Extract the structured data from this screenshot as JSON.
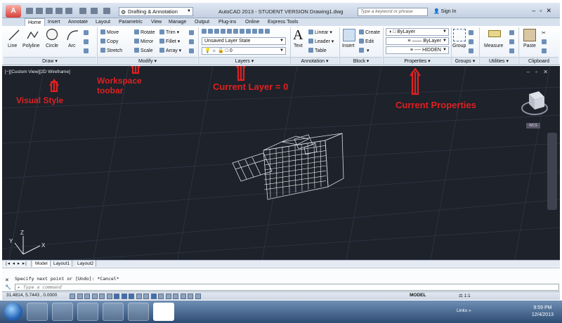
{
  "titlebar": {
    "workspace": "Drafting & Annotation",
    "title": "AutoCAD 2013 - STUDENT VERSION   Drawing1.dwg",
    "search_placeholder": "Type a keyword or phrase",
    "signin": "Sign In"
  },
  "tabs": [
    "Home",
    "Insert",
    "Annotate",
    "Layout",
    "Parametric",
    "View",
    "Manage",
    "Output",
    "Plug-ins",
    "Online",
    "Express Tools"
  ],
  "ribbon": {
    "draw": {
      "line": "Line",
      "polyline": "Polyline",
      "circle": "Circle",
      "arc": "Arc",
      "label": "Draw"
    },
    "modify": {
      "move": "Move",
      "rotate": "Rotate",
      "trim": "Trim",
      "copy": "Copy",
      "mirror": "Mirror",
      "fillet": "Fillet",
      "stretch": "Stretch",
      "scale": "Scale",
      "array": "Array",
      "label": "Modify"
    },
    "layers": {
      "layer_state": "Unsaved Layer State",
      "current_layer": "0",
      "label": "Layers"
    },
    "annotation": {
      "text": "Text",
      "linear": "Linear",
      "leader": "Leader",
      "table": "Table",
      "label": "Annotation"
    },
    "block": {
      "insert": "Insert",
      "create": "Create",
      "edit": "Edit",
      "label": "Block"
    },
    "properties": {
      "color": "ByLayer",
      "linetype": "ByLayer",
      "lineweight": "HIDDEN",
      "label": "Properties"
    },
    "groups": {
      "group": "Group",
      "label": "Groups"
    },
    "utilities": {
      "measure": "Measure",
      "label": "Utilities"
    },
    "clipboard": {
      "paste": "Paste",
      "label": "Clipboard"
    }
  },
  "viewport": {
    "label": "[−][Custom View][2D Wireframe]",
    "wcs": "WCS",
    "annotations": {
      "visual_style": "Visual Style",
      "workspace_toolbar": "Workspace\ntoobar",
      "current_layer": "Current Layer = 0",
      "current_properties": "Current Properties"
    }
  },
  "layout_tabs": [
    "Model",
    "Layout1",
    "Layout2"
  ],
  "command": {
    "history": "Specify next point or [Undo]: *Cancel*",
    "placeholder": "Type a command"
  },
  "status": {
    "coords": "31.4814, 5.7443 , 0.0000",
    "model": "MODEL",
    "scale": "1:1"
  },
  "taskbar": {
    "links": "Links",
    "time": "9:59 PM",
    "date": "12/4/2013"
  },
  "colors": {
    "annotation": "#e02020",
    "viewport_bg": "#1d222b",
    "ribbon_accent": "#3f6fb3"
  }
}
